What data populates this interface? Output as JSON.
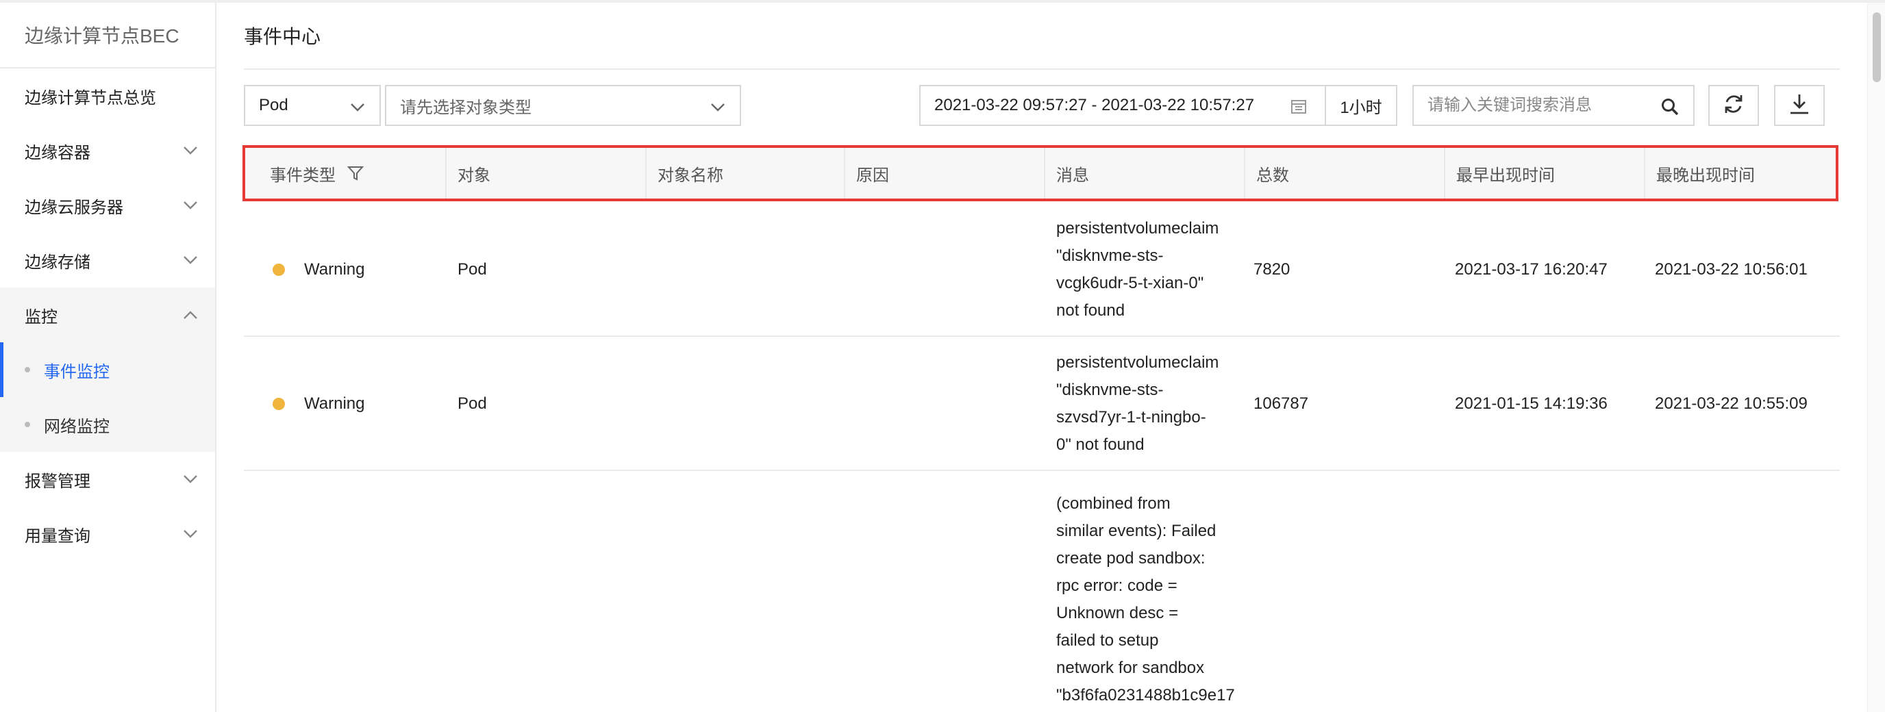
{
  "sidebar": {
    "title": "边缘计算节点BEC",
    "items": [
      {
        "label": "边缘计算节点总览"
      },
      {
        "label": "边缘容器"
      },
      {
        "label": "边缘云服务器"
      },
      {
        "label": "边缘存储"
      },
      {
        "label": "监控"
      },
      {
        "label": "报警管理"
      },
      {
        "label": "用量查询"
      }
    ],
    "sub_items": [
      {
        "label": "事件监控"
      },
      {
        "label": "网络监控"
      }
    ]
  },
  "main": {
    "title": "事件中心",
    "filters": {
      "resource_select": "Pod",
      "object_type_placeholder": "请先选择对象类型",
      "date_range": "2021-03-22 09:57:27 - 2021-03-22 10:57:27",
      "range_button": "1小时",
      "search_placeholder": "请输入关键词搜索消息"
    },
    "table": {
      "headers": [
        "事件类型",
        "对象",
        "对象名称",
        "原因",
        "消息",
        "总数",
        "最早出现时间",
        "最晚出现时间"
      ],
      "rows": [
        {
          "type": "Warning",
          "object": "Pod",
          "object_name": "",
          "reason": "",
          "message": "persistentvolumeclaim\n\"disknvme-sts-\nvcgk6udr-5-t-xian-0\"\nnot found",
          "count": "7820",
          "first_seen": "2021-03-17 16:20:47",
          "last_seen": "2021-03-22 10:56:01"
        },
        {
          "type": "Warning",
          "object": "Pod",
          "object_name": "",
          "reason": "",
          "message": "persistentvolumeclaim\n\"disknvme-sts-\nszvsd7yr-1-t-ningbo-\n0\" not found",
          "count": "106787",
          "first_seen": "2021-01-15 14:19:36",
          "last_seen": "2021-03-22 10:55:09"
        },
        {
          "type": "",
          "object": "",
          "object_name": "",
          "reason": "",
          "message": "(combined from\nsimilar events): Failed\ncreate pod sandbox:\nrpc error: code =\nUnknown desc =\nfailed to setup\nnetwork for sandbox\n\"b3f6fa0231488b1c9e17\n...",
          "count": "",
          "first_seen": "",
          "last_seen": ""
        }
      ]
    }
  },
  "colors": {
    "accent": "#2468f2",
    "warning_dot": "#f0b43c",
    "highlight_border": "#e53935"
  }
}
